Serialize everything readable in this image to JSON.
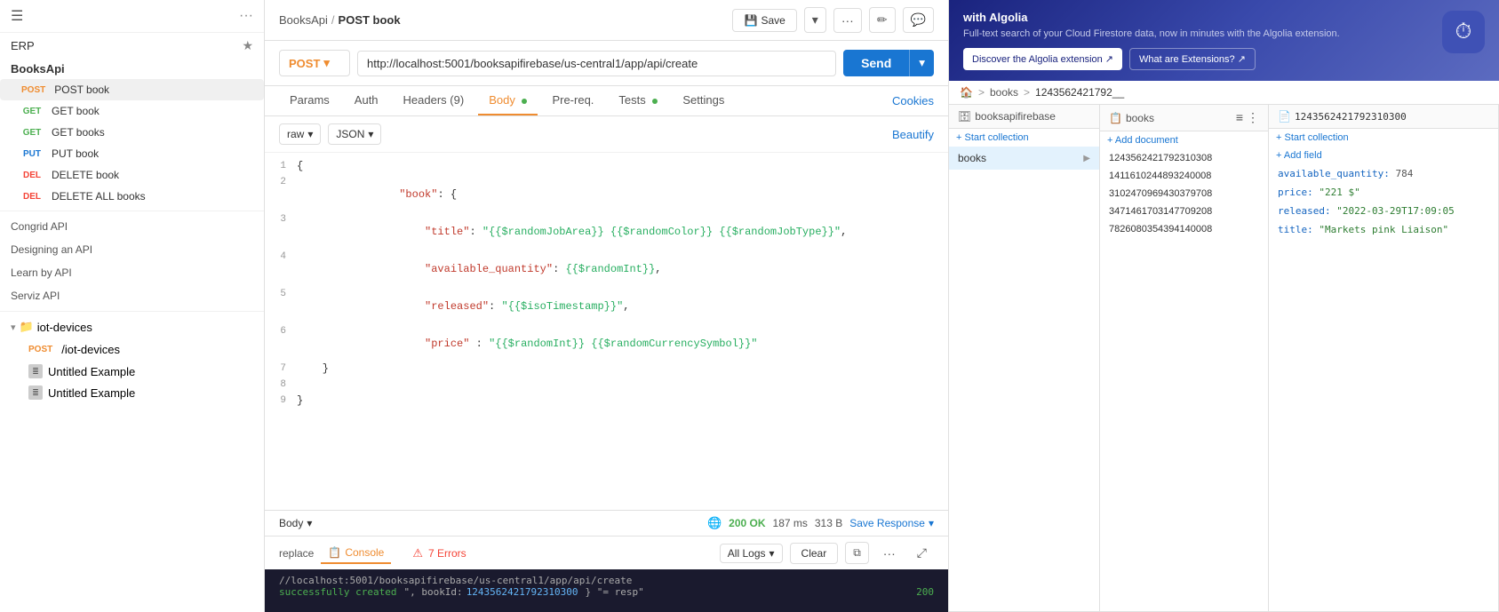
{
  "sidebar": {
    "menu_icon": "☰",
    "dots_icon": "···",
    "erp_label": "ERP",
    "star_icon": "★",
    "booksapi_label": "BooksApi",
    "items": [
      {
        "method": "POST",
        "method_class": "method-post",
        "label": "POST book",
        "active": true
      },
      {
        "method": "GET",
        "method_class": "method-get",
        "label": "GET book",
        "active": false
      },
      {
        "method": "GET",
        "method_class": "method-get",
        "label": "GET books",
        "active": false
      },
      {
        "method": "PUT",
        "method_class": "method-put",
        "label": "PUT book",
        "active": false
      },
      {
        "method": "DEL",
        "method_class": "method-del",
        "label": "DELETE book",
        "active": false
      },
      {
        "method": "DEL",
        "method_class": "method-del",
        "label": "DELETE ALL books",
        "active": false
      }
    ],
    "congrid_label": "Congrid API",
    "designing_label": "Designing an API",
    "learn_label": "Learn by API",
    "serviz_label": "Serviz API",
    "iot_group_label": "iot-devices",
    "iot_expand_arrow": "▾",
    "iot_post_label": "/iot-devices",
    "iot_sub_items": [
      {
        "label": "Untitled Example"
      },
      {
        "label": "Untitled Example"
      }
    ]
  },
  "topbar": {
    "breadcrumb_collection": "BooksApi",
    "breadcrumb_sep": "/",
    "breadcrumb_current": "POST book",
    "save_label": "Save",
    "save_icon": "💾",
    "arrow_icon": "▾",
    "more_icon": "···",
    "edit_icon": "✏",
    "comment_icon": "💬"
  },
  "request_bar": {
    "method": "POST",
    "method_arrow": "▾",
    "url": "http://localhost:5001/booksapifirebase/us-central1/app/api/create",
    "send_label": "Send",
    "send_arrow": "▾"
  },
  "tabs": {
    "items": [
      {
        "label": "Params",
        "active": false,
        "dot": false
      },
      {
        "label": "Auth",
        "active": false,
        "dot": false
      },
      {
        "label": "Headers (9)",
        "active": false,
        "dot": false
      },
      {
        "label": "Body",
        "active": true,
        "dot": true,
        "dot_color": "green"
      },
      {
        "label": "Pre-req.",
        "active": false,
        "dot": false
      },
      {
        "label": "Tests",
        "active": false,
        "dot": true,
        "dot_color": "green"
      },
      {
        "label": "Settings",
        "active": false,
        "dot": false
      }
    ],
    "cookies_label": "Cookies"
  },
  "body_toolbar": {
    "raw_label": "raw",
    "raw_arrow": "▾",
    "json_label": "JSON",
    "json_arrow": "▾",
    "beautify_label": "Beautify"
  },
  "code": {
    "lines": [
      {
        "num": 1,
        "content": "{"
      },
      {
        "num": 2,
        "content": "    \"book\": {"
      },
      {
        "num": 3,
        "content": "        \"title\": \"{{$randomJobArea}} {{$randomColor}} {{$randomJobType}}\","
      },
      {
        "num": 4,
        "content": "        \"available_quantity\": {{$randomInt}},"
      },
      {
        "num": 5,
        "content": "        \"released\": \"{{$isoTimestamp}}\","
      },
      {
        "num": 6,
        "content": "        \"price\" : \"{{$randomInt}} {{$randomCurrencySymbol}}\""
      },
      {
        "num": 7,
        "content": "    }"
      },
      {
        "num": 8,
        "content": ""
      },
      {
        "num": 9,
        "content": "}"
      }
    ]
  },
  "status_bar": {
    "body_label": "Body",
    "body_arrow": "▾",
    "globe_icon": "🌐",
    "status_code": "200 OK",
    "response_time": "187 ms",
    "response_size": "313 B",
    "save_response_label": "Save Response",
    "save_response_arrow": "▾"
  },
  "console": {
    "replace_label": "replace",
    "tab_label": "Console",
    "tab_icon": "📋",
    "errors_label": "7 Errors",
    "error_icon": "⚠",
    "logs_label": "All Logs",
    "logs_arrow": "▾",
    "clear_label": "Clear",
    "copy_icon": "⧉",
    "more_icon": "···",
    "expand_icon": "⤢",
    "url_line": "//localhost:5001/booksapifirebase/us-central1/app/api/create",
    "success_line": "successfully created: \", bookId: 1243562421792310300} \" = resp\"",
    "success_text": "successfully created",
    "book_id_label": "bookId:",
    "book_id_value": "1243562421792310300",
    "resp_var": "= resp",
    "status_200": "200"
  },
  "firestore": {
    "algolia_title": "with Algolia",
    "algolia_desc": "Full-text search of your Cloud Firestore data, now in minutes with the Algolia extension.",
    "algolia_btn1": "Discover the Algolia extension ↗",
    "algolia_btn2": "What are Extensions? ↗",
    "algolia_icon": "⏱",
    "nav_home_icon": "🏠",
    "nav_sep": ">",
    "nav_books": "books",
    "nav_sep2": ">",
    "nav_current": "1243562421792__",
    "col1_title": "booksapifirebase",
    "col2_title": "books",
    "col3_title": "1243562421792310300",
    "add_collection": "+ Start collection",
    "add_document": "+ Add document",
    "add_collection2": "+ Start collection",
    "add_field": "+ Add field",
    "col1_item": "books",
    "col2_ids": [
      "1243562421792310308",
      "1411610244893240008",
      "3102470969430379708",
      "3471461703147709208",
      "7826080354394140008"
    ],
    "doc_id": "1243562421792310300",
    "fields": [
      {
        "name": "available_quantity:",
        "value": "784"
      },
      {
        "name": "price:",
        "value": "\"221 $\""
      },
      {
        "name": "released:",
        "value": "\"2022-03-29T17:09:05"
      },
      {
        "name": "title:",
        "value": "\"Markets pink Liaison\""
      }
    ]
  }
}
